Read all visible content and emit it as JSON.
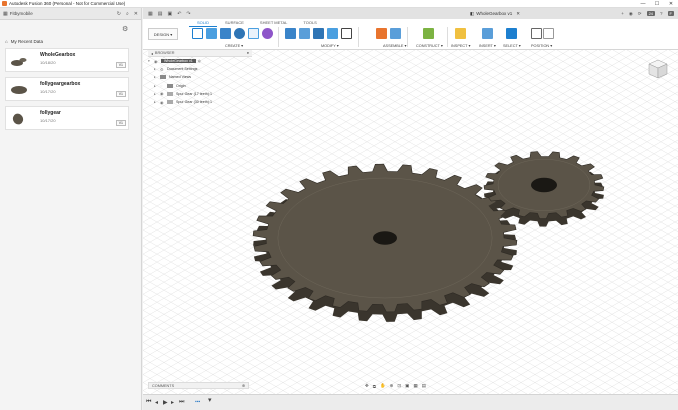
{
  "window": {
    "title": "Autodesk Fusion 360 (Personal - Not for Commercial Use)",
    "controls": [
      "—",
      "☐",
      "✕"
    ]
  },
  "data_panel": {
    "account": "Fitbymobile",
    "project": "My Recent Data",
    "files": [
      {
        "name": "WholeGearbox",
        "date": "10/18/20",
        "version": "V1"
      },
      {
        "name": "follygeargearbox",
        "date": "10/17/20",
        "version": "V1"
      },
      {
        "name": "follygear",
        "date": "10/17/20",
        "version": "V1"
      }
    ]
  },
  "tabs": {
    "document": "WholeGearbox v1",
    "count": "24",
    "user": "F"
  },
  "ribbon": {
    "tabs": [
      "SOLID",
      "SURFACE",
      "SHEET METAL",
      "TOOLS"
    ],
    "active_tab": "SOLID",
    "workspace": "DESIGN ▾",
    "groups": [
      "CREATE ▾",
      "MODIFY ▾",
      "ASSEMBLE ▾",
      "CONSTRUCT ▾",
      "INSPECT ▾",
      "INSERT ▾",
      "SELECT ▾",
      "POSITION ▾"
    ]
  },
  "browser": {
    "header": "BROWSER",
    "root": "WholeGearbox v1",
    "items": [
      "Document Settings",
      "Named Views",
      "Origin",
      "Spur Gear (17 teeth):1",
      "Spur Gear (30 teeth):1"
    ]
  },
  "comments": {
    "label": "COMMENTS"
  },
  "accent": "#1d7fcf",
  "gear_color": "#5b5448"
}
